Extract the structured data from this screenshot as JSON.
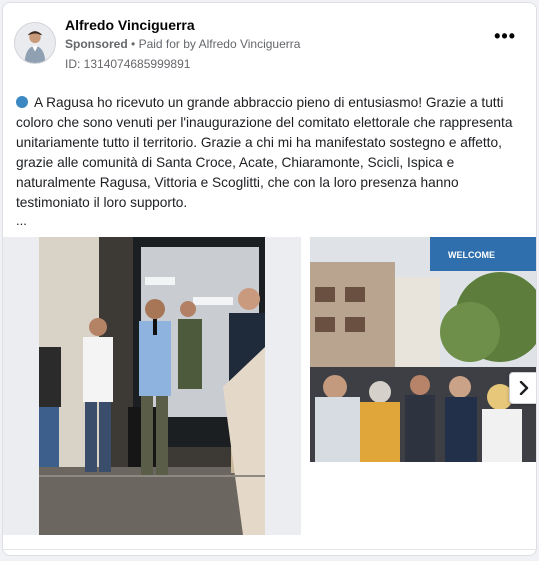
{
  "post": {
    "author": "Alfredo Vinciguerra",
    "sponsored": "Sponsored",
    "separator": "•",
    "paid_for_prefix": "Paid for by",
    "paid_for_name": "Alfredo Vinciguerra",
    "id_text": "ID: 1314074685999891",
    "more_menu": "•••",
    "body": "A Ragusa ho ricevuto un grande abbraccio pieno di entusiasmo! Grazie a tutti coloro che sono venuti per l'inaugurazione del comitato elettorale che rappresenta unitariamente tutto il territorio. Grazie a chi mi ha manifestato sostegno e affetto, grazie alle comunità di Santa Croce, Acate, Chiaramonte, Scicli, Ispica e naturalmente Ragusa, Vittoria e Scoglitti, che con la loro presenza hanno testimoniato il loro supporto.",
    "truncation": "...",
    "dot_icon": "blue-circle-icon",
    "dot_color": "#3b88c3"
  },
  "media": {
    "sign_text": "WELCOME"
  },
  "icons": {
    "avatar": "profile-photo",
    "next": "chevron-right-icon"
  }
}
